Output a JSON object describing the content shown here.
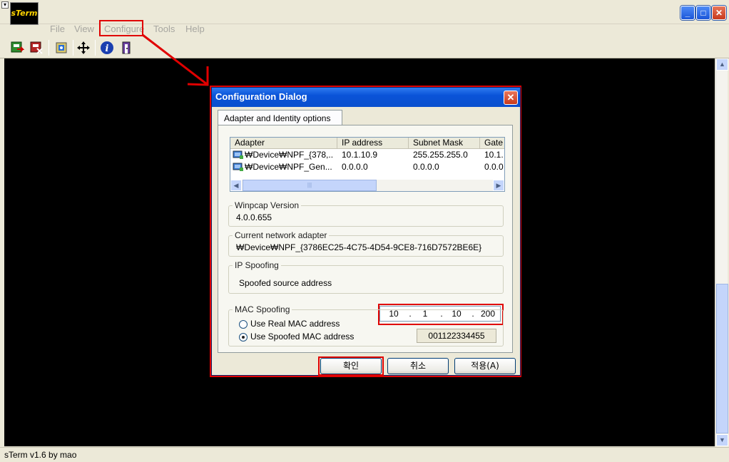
{
  "app": {
    "logo_text": "sTerm",
    "status": "sTerm v1.6 by mao"
  },
  "menu": {
    "file": "File",
    "view": "View",
    "configure": "Configure",
    "tools": "Tools",
    "help": "Help"
  },
  "toolbar": {
    "icons": [
      "connect-icon",
      "disconnect-icon",
      "capture-icon",
      "move-icon",
      "info-icon",
      "exit-icon"
    ]
  },
  "dialog": {
    "title": "Configuration Dialog",
    "tab": "Adapter and Identity options",
    "list": {
      "columns": [
        "Adapter",
        "IP address",
        "Subnet Mask",
        "Gate"
      ],
      "rows": [
        [
          "₩Device₩NPF_{378,..",
          "10.1.10.9",
          "255.255.255.0",
          "10.1."
        ],
        [
          "₩Device₩NPF_Gen...",
          "0.0.0.0",
          "0.0.0.0",
          "0.0.0"
        ]
      ]
    },
    "winpcap": {
      "label": "Winpcap Version",
      "value": "4.0.0.655"
    },
    "current_adapter": {
      "label": "Current network adapter",
      "value": "₩Device₩NPF_{3786EC25-4C75-4D54-9CE8-716D7572BE6E}"
    },
    "ip_spoofing": {
      "label": "IP Spoofing",
      "field_label": "Spoofed source address",
      "octets": [
        "10",
        "1",
        "10",
        "200"
      ]
    },
    "mac_spoofing": {
      "label": "MAC Spoofing",
      "option_real": "Use Real MAC address",
      "option_spoofed": "Use Spoofed MAC address",
      "selected": "spoofed",
      "mac_value": "001122334455"
    },
    "buttons": {
      "ok": "확인",
      "cancel": "취소",
      "apply": "적용(A)"
    }
  },
  "colors": {
    "annotation": "#e00000",
    "terminal_bg": "#000000",
    "titlebar_blue": "#0a53d8"
  }
}
